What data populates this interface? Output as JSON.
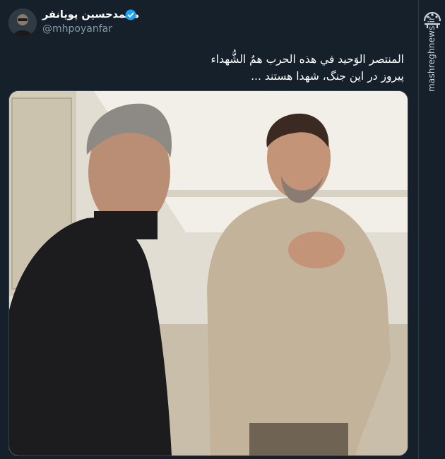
{
  "tweet": {
    "display_name": "محمدحسين پويانفر",
    "handle": "@mhpoyanfar",
    "verified": true,
    "text_line_1": "المنتصر الوَحيد في هذه الحرب همُ الشُّهداء",
    "text_line_2": "پیروز در این جنگ، شهدا هستند ..."
  },
  "media": {
    "icon": "photo"
  },
  "brand": {
    "logo_text": "مشرق",
    "site": "mashreghnews.ir"
  },
  "colors": {
    "background": "#15202b",
    "handle": "#8899a6",
    "verified": "#1da1f2",
    "border": "#38444d"
  }
}
